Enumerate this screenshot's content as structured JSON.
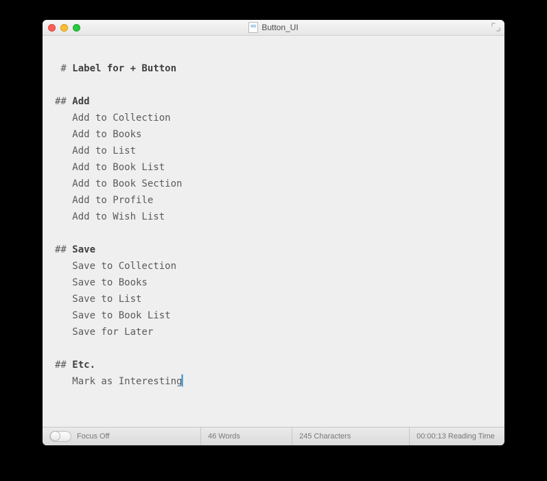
{
  "window": {
    "title": "Button_UI"
  },
  "document": {
    "h1": "Label for + Button",
    "sections": [
      {
        "heading": "Add",
        "lines": [
          "Add to Collection",
          "Add to Books",
          "Add to List",
          "Add to Book List",
          "Add to Book Section",
          "Add to Profile",
          "Add to Wish List"
        ]
      },
      {
        "heading": "Save",
        "lines": [
          "Save to Collection",
          "Save to Books",
          "Save to List",
          "Save to Book List",
          "Save for Later"
        ]
      },
      {
        "heading": "Etc.",
        "lines": [
          "Mark as Interesting"
        ]
      }
    ]
  },
  "status": {
    "focus_label": "Focus Off",
    "words": "46 Words",
    "characters": "245 Characters",
    "reading_time": "00:00:13 Reading Time"
  }
}
